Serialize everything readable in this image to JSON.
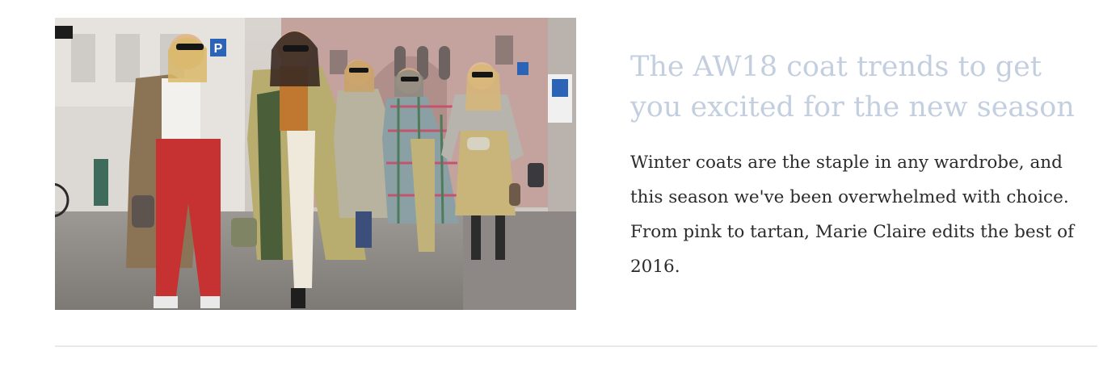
{
  "article": {
    "title": "The AW18 coat trends to get you excited for the new season",
    "excerpt": "Winter coats are the staple in any wardrobe, and this season we've been overwhelmed with choice. From pink to tartan, Marie Claire edits the best of 2016.",
    "image": {
      "subject": "street-style photo of five women walking in coats",
      "sign_text": "P"
    }
  },
  "colors": {
    "title": "#c3cfdf",
    "excerpt": "#2b2b2b",
    "divider": "#e9e9ec",
    "background": "#ffffff"
  }
}
